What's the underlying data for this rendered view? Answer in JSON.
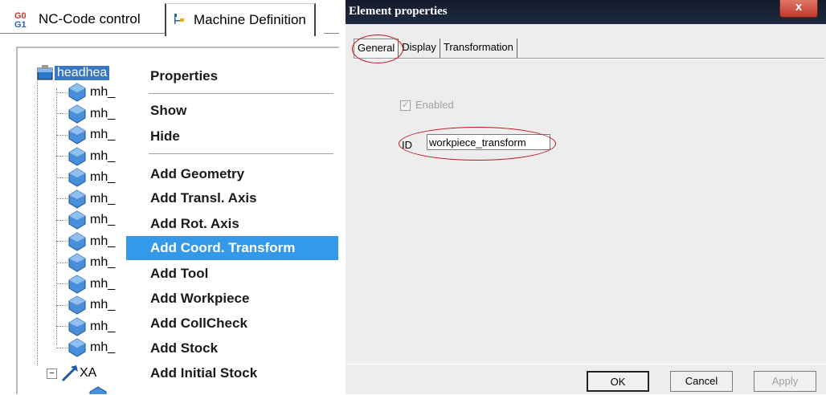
{
  "left_panel": {
    "tabs": [
      {
        "label": "NC-Code control",
        "icon": "nc-code-icon"
      },
      {
        "label": "Machine Definition",
        "icon": "machine-tree-icon"
      }
    ],
    "tree": {
      "root_label": "headhea",
      "children": [
        "mh_",
        "mh_",
        "mh_",
        "mh_",
        "mh_",
        "mh_",
        "mh_",
        "mh_",
        "mh_",
        "mh_",
        "mh_",
        "mh_",
        "mh_"
      ],
      "axis_label": "XA"
    }
  },
  "context_menu": {
    "items": [
      {
        "label": "Properties"
      },
      {
        "label": "Show"
      },
      {
        "label": "Hide"
      },
      {
        "label": "Add Geometry"
      },
      {
        "label": "Add Transl. Axis"
      },
      {
        "label": "Add Rot. Axis"
      },
      {
        "label": "Add Coord. Transform"
      },
      {
        "label": "Add Tool"
      },
      {
        "label": "Add Workpiece"
      },
      {
        "label": "Add CollCheck"
      },
      {
        "label": "Add Stock"
      },
      {
        "label": "Add Initial Stock"
      }
    ],
    "highlighted": "Add Coord. Transform"
  },
  "dialog": {
    "title": "Element properties",
    "close_label": "x",
    "tabs": [
      "General",
      "Display",
      "Transformation"
    ],
    "active_tab": "General",
    "enabled_label": "Enabled",
    "enabled_checked": true,
    "id_label": "ID",
    "id_value": "workpiece_transform",
    "buttons": {
      "ok": "OK",
      "cancel": "Cancel",
      "apply": "Apply"
    }
  },
  "colors": {
    "menu_highlight": "#3399e8",
    "title_bar": "#131b2b",
    "annotation_ring": "#c01616"
  }
}
